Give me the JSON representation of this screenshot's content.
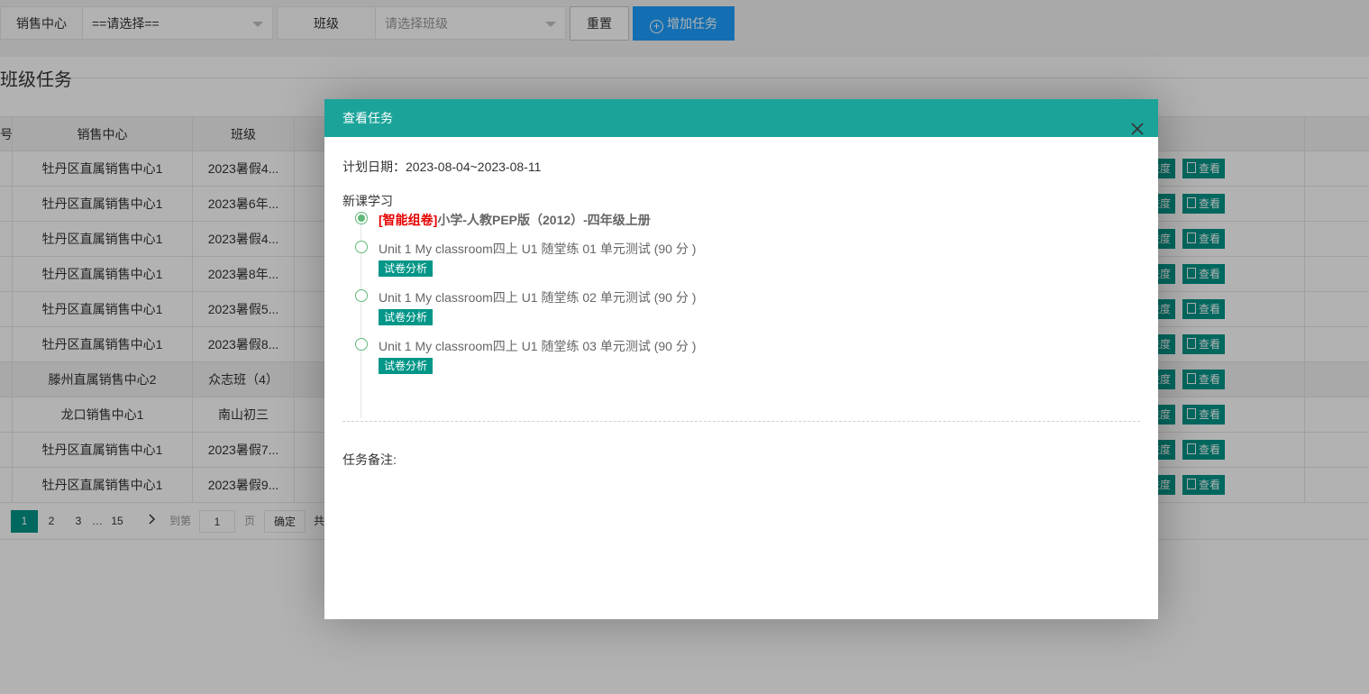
{
  "filters": {
    "center_label": "销售中心",
    "center_value": "==请选择==",
    "class_label": "班级",
    "class_placeholder": "请选择班级",
    "reset_label": "重置",
    "add_label": "增加任务"
  },
  "section": {
    "title": "班级任务"
  },
  "table": {
    "headers": {
      "no": "号",
      "center": "销售中心",
      "class": "班级"
    },
    "rows": [
      {
        "center": "牡丹区直属销售中心1",
        "class": "2023暑假4...",
        "progress": "进度",
        "view": "查看"
      },
      {
        "center": "牡丹区直属销售中心1",
        "class": "2023暑6年...",
        "progress": "进度",
        "view": "查看"
      },
      {
        "center": "牡丹区直属销售中心1",
        "class": "2023暑假4...",
        "progress": "进度",
        "view": "查看"
      },
      {
        "center": "牡丹区直属销售中心1",
        "class": "2023暑8年...",
        "progress": "进度",
        "view": "查看"
      },
      {
        "center": "牡丹区直属销售中心1",
        "class": "2023暑假5...",
        "progress": "进度",
        "view": "查看"
      },
      {
        "center": "牡丹区直属销售中心1",
        "class": "2023暑假8...",
        "progress": "进度",
        "view": "查看"
      },
      {
        "center": "滕州直属销售中心2",
        "class": "众志班（4）",
        "progress": "进度",
        "view": "查看"
      },
      {
        "center": "龙口销售中心1",
        "class": "南山初三",
        "progress": "进度",
        "view": "查看"
      },
      {
        "center": "牡丹区直属销售中心1",
        "class": "2023暑假7...",
        "progress": "进度",
        "view": "查看"
      },
      {
        "center": "牡丹区直属销售中心1",
        "class": "2023暑假9...",
        "progress": "进度",
        "view": "查看"
      }
    ]
  },
  "pagination": {
    "pages": [
      "1",
      "2",
      "3",
      "…",
      "15"
    ],
    "goto_label": "到第",
    "goto_value": "1",
    "page_unit": "页",
    "confirm_label": "确定",
    "total_prefix": "共"
  },
  "modal": {
    "title": "查看任务",
    "plan_date": "计划日期：2023-08-04~2023-08-11",
    "group_title": "新课学习",
    "paper": {
      "tag": "[智能组卷]",
      "name": "小学-人教PEP版（2012）-四年级上册"
    },
    "items": [
      {
        "text": "Unit 1 My classroom四上 U1 随堂练 01 单元测试 (90 分 )",
        "badge": "试卷分析"
      },
      {
        "text": "Unit 1 My classroom四上 U1 随堂练 02 单元测试 (90 分 )",
        "badge": "试卷分析"
      },
      {
        "text": "Unit 1 My classroom四上 U1 随堂练 03 单元测试 (90 分 )",
        "badge": "试卷分析"
      }
    ],
    "remark_label": "任务备注:"
  },
  "colors": {
    "primary": "#009688",
    "modal_header": "#1ba399",
    "blue": "#1e9fff",
    "red_tag": "#e60000"
  }
}
